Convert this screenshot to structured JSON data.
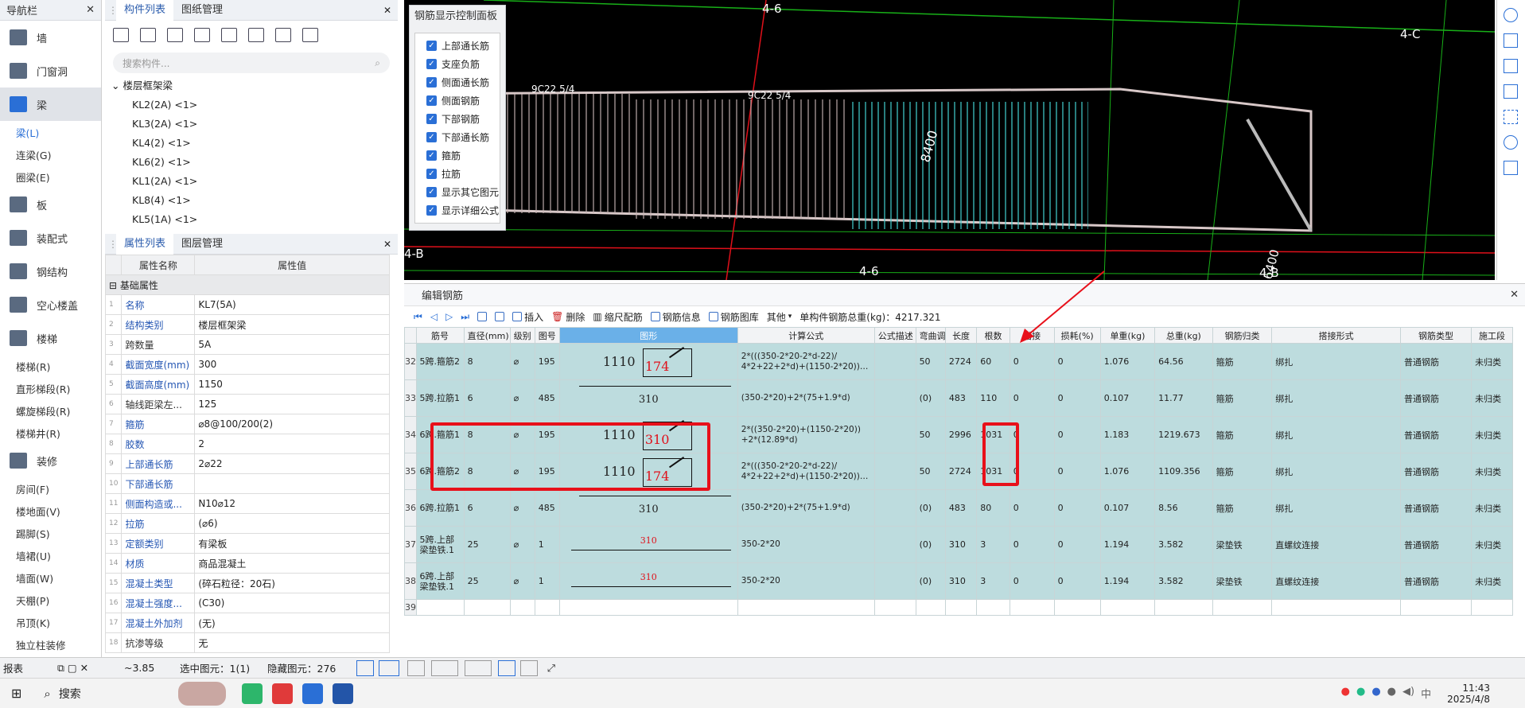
{
  "nav": {
    "title": "导航栏",
    "items": [
      {
        "label": "墙",
        "type": "main"
      },
      {
        "label": "门窗洞",
        "type": "main"
      },
      {
        "label": "梁",
        "type": "main",
        "active": true
      },
      {
        "label": "梁(L)",
        "type": "sub",
        "active": true
      },
      {
        "label": "连梁(G)",
        "type": "sub"
      },
      {
        "label": "圈梁(E)",
        "type": "sub"
      },
      {
        "label": "板",
        "type": "main"
      },
      {
        "label": "装配式",
        "type": "main"
      },
      {
        "label": "钢结构",
        "type": "main"
      },
      {
        "label": "空心楼盖",
        "type": "main"
      },
      {
        "label": "楼梯",
        "type": "main"
      },
      {
        "label": "楼梯(R)",
        "type": "sub"
      },
      {
        "label": "直形梯段(R)",
        "type": "sub"
      },
      {
        "label": "螺旋梯段(R)",
        "type": "sub"
      },
      {
        "label": "楼梯井(R)",
        "type": "sub"
      },
      {
        "label": "装修",
        "type": "main"
      },
      {
        "label": "房间(F)",
        "type": "sub"
      },
      {
        "label": "楼地面(V)",
        "type": "sub"
      },
      {
        "label": "踢脚(S)",
        "type": "sub"
      },
      {
        "label": "墙裙(U)",
        "type": "sub"
      },
      {
        "label": "墙面(W)",
        "type": "sub"
      },
      {
        "label": "天棚(P)",
        "type": "sub"
      },
      {
        "label": "吊顶(K)",
        "type": "sub"
      },
      {
        "label": "独立柱装修",
        "type": "sub"
      }
    ]
  },
  "component_panel": {
    "tabs": [
      "构件列表",
      "图纸管理"
    ],
    "search_placeholder": "搜索构件...",
    "tree_root": "楼层框架梁",
    "items": [
      "KL2(2A) <1>",
      "KL3(2A) <1>",
      "KL4(2) <1>",
      "KL6(2) <1>",
      "KL1(2A) <1>",
      "KL8(4) <1>",
      "KL5(1A) <1>"
    ]
  },
  "property_panel": {
    "tabs": [
      "属性列表",
      "图层管理"
    ],
    "col_name": "属性名称",
    "col_value": "属性值",
    "section": "基础属性",
    "rows": [
      {
        "n": "1",
        "name": "名称",
        "value": "KL7(5A)"
      },
      {
        "n": "2",
        "name": "结构类别",
        "value": "楼层框架梁"
      },
      {
        "n": "3",
        "name": "跨数量",
        "value": "5A",
        "gray": true
      },
      {
        "n": "4",
        "name": "截面宽度(mm)",
        "value": "300"
      },
      {
        "n": "5",
        "name": "截面高度(mm)",
        "value": "1150"
      },
      {
        "n": "6",
        "name": "轴线距梁左...",
        "value": "125",
        "gray": true
      },
      {
        "n": "7",
        "name": "箍筋",
        "value": "⌀8@100/200(2)"
      },
      {
        "n": "8",
        "name": "胶数",
        "value": "2"
      },
      {
        "n": "9",
        "name": "上部通长筋",
        "value": "2⌀22"
      },
      {
        "n": "10",
        "name": "下部通长筋",
        "value": ""
      },
      {
        "n": "11",
        "name": "侧面构造或...",
        "value": "N10⌀12"
      },
      {
        "n": "12",
        "name": "拉筋",
        "value": "(⌀6)"
      },
      {
        "n": "13",
        "name": "定额类别",
        "value": "有梁板"
      },
      {
        "n": "14",
        "name": "材质",
        "value": "商品混凝土"
      },
      {
        "n": "15",
        "name": "混凝土类型",
        "value": "(碎石粒径：20石)"
      },
      {
        "n": "16",
        "name": "混凝土强度...",
        "value": "(C30)"
      },
      {
        "n": "17",
        "name": "混凝土外加剂",
        "value": "(无)"
      },
      {
        "n": "18",
        "name": "抗渗等级",
        "value": "无",
        "gray": true
      }
    ]
  },
  "viewport": {
    "labels": {
      "top_grid": "4-6",
      "right_grid": "4-C",
      "left_grid": "4-B",
      "bottom_grid": "4-6",
      "bottom_right_grid": "4-B",
      "dim_right": "8400",
      "dim_bottom": "6400",
      "rebar1": "9C22 5/4",
      "rebar2": "9C22 5/4"
    }
  },
  "control_panel": {
    "title": "钢筋显示控制面板",
    "items": [
      "上部通长筋",
      "支座负筋",
      "侧面通长筋",
      "侧面钢筋",
      "下部钢筋",
      "下部通长筋",
      "箍筋",
      "拉筋",
      "显示其它图元",
      "显示详细公式"
    ]
  },
  "editor": {
    "title": "编辑钢筋",
    "toolbar": {
      "insert": "插入",
      "delete": "删除",
      "scale": "缩尺配筋",
      "info": "钢筋信息",
      "library": "钢筋图库",
      "other": "其他",
      "total": "单构件钢筋总重(kg)：4217.321"
    },
    "headers": [
      "筋号",
      "直径(mm)",
      "级别",
      "图号",
      "图形",
      "计算公式",
      "公式描述",
      "弯曲调整",
      "长度",
      "根数",
      "搭接",
      "损耗(%)",
      "单重(kg)",
      "总重(kg)",
      "钢筋归类",
      "搭接形式",
      "钢筋类型",
      "施工段"
    ],
    "rows": [
      {
        "idx": "32",
        "name": "5跨.箍筋2",
        "dia": "8",
        "grade": "⌀",
        "fig": "195",
        "s1": "1110",
        "s2": "174",
        "formula": "2*(((350-2*20-2*d-22)/ 4*2+22+2*d)+(1150-2*20))…",
        "desc": "",
        "bend": "50",
        "len": "2724",
        "count": "60",
        "lap": "0",
        "loss": "0",
        "unit": "1.076",
        "total": "64.56",
        "cat": "箍筋",
        "lapType": "绑扎",
        "type": "普通钢筋",
        "seg": "未归类",
        "kind": "stirrup"
      },
      {
        "idx": "33",
        "name": "5跨.拉筋1",
        "dia": "6",
        "grade": "⌀",
        "fig": "485",
        "s1": "310",
        "s2": "",
        "formula": "(350-2*20)+2*(75+1.9*d)",
        "desc": "",
        "bend": "(0)",
        "len": "483",
        "count": "110",
        "lap": "0",
        "loss": "0",
        "unit": "0.107",
        "total": "11.77",
        "cat": "箍筋",
        "lapType": "绑扎",
        "type": "普通钢筋",
        "seg": "未归类",
        "kind": "tie"
      },
      {
        "idx": "34",
        "name": "6跨.箍筋1",
        "dia": "8",
        "grade": "⌀",
        "fig": "195",
        "s1": "1110",
        "s2": "310",
        "formula": "2*((350-2*20)+(1150-2*20)) +2*(12.89*d)",
        "desc": "",
        "bend": "50",
        "len": "2996",
        "count": "1031",
        "lap": "0",
        "loss": "0",
        "unit": "1.183",
        "total": "1219.673",
        "cat": "箍筋",
        "lapType": "绑扎",
        "type": "普通钢筋",
        "seg": "未归类",
        "kind": "stirrup"
      },
      {
        "idx": "35",
        "name": "6跨.箍筋2",
        "dia": "8",
        "grade": "⌀",
        "fig": "195",
        "s1": "1110",
        "s2": "174",
        "formula": "2*(((350-2*20-2*d-22)/ 4*2+22+2*d)+(1150-2*20))…",
        "desc": "",
        "bend": "50",
        "len": "2724",
        "count": "1031",
        "lap": "0",
        "loss": "0",
        "unit": "1.076",
        "total": "1109.356",
        "cat": "箍筋",
        "lapType": "绑扎",
        "type": "普通钢筋",
        "seg": "未归类",
        "kind": "stirrup"
      },
      {
        "idx": "36",
        "name": "6跨.拉筋1",
        "dia": "6",
        "grade": "⌀",
        "fig": "485",
        "s1": "310",
        "s2": "",
        "formula": "(350-2*20)+2*(75+1.9*d)",
        "desc": "",
        "bend": "(0)",
        "len": "483",
        "count": "80",
        "lap": "0",
        "loss": "0",
        "unit": "0.107",
        "total": "8.56",
        "cat": "箍筋",
        "lapType": "绑扎",
        "type": "普通钢筋",
        "seg": "未归类",
        "kind": "tie"
      },
      {
        "idx": "37",
        "name": "5跨.上部梁垫铁.1",
        "dia": "25",
        "grade": "⌀",
        "fig": "1",
        "s1": "310",
        "s2": "",
        "formula": "350-2*20",
        "desc": "",
        "bend": "(0)",
        "len": "310",
        "count": "3",
        "lap": "0",
        "loss": "0",
        "unit": "1.194",
        "total": "3.582",
        "cat": "梁垫铁",
        "lapType": "直螺纹连接",
        "type": "普通钢筋",
        "seg": "未归类",
        "kind": "line"
      },
      {
        "idx": "38",
        "name": "6跨.上部梁垫铁.1",
        "dia": "25",
        "grade": "⌀",
        "fig": "1",
        "s1": "310",
        "s2": "",
        "formula": "350-2*20",
        "desc": "",
        "bend": "(0)",
        "len": "310",
        "count": "3",
        "lap": "0",
        "loss": "0",
        "unit": "1.194",
        "total": "3.582",
        "cat": "梁垫铁",
        "lapType": "直螺纹连接",
        "type": "普通钢筋",
        "seg": "未归类",
        "kind": "line"
      }
    ],
    "empty_row": "39"
  },
  "status": {
    "report": "报表",
    "elev": "~3.85",
    "selected": "选中图元：1(1)",
    "hidden": "隐藏图元：276"
  },
  "taskbar": {
    "search": "搜索",
    "time": "11:43",
    "date": "2025/4/8"
  }
}
